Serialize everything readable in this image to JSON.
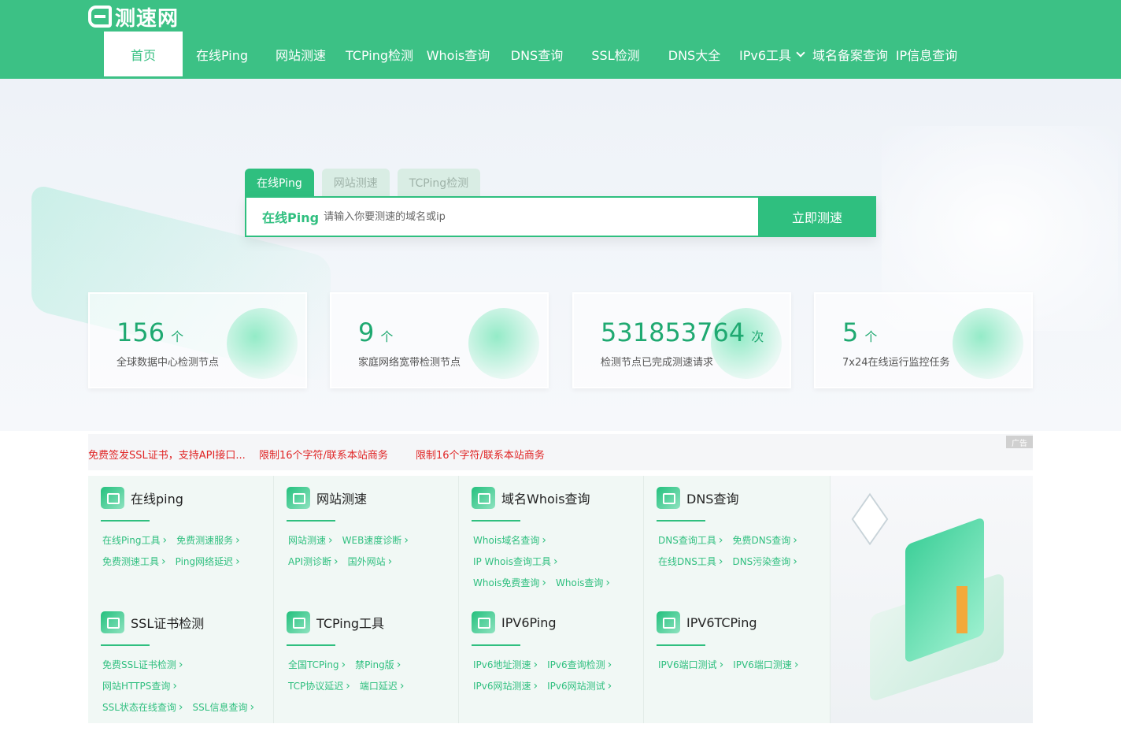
{
  "header": {
    "logo_text": "测速网",
    "nav": [
      {
        "label": "首页",
        "active": true
      },
      {
        "label": "在线Ping"
      },
      {
        "label": "网站测速"
      },
      {
        "label": "TCPing检测"
      },
      {
        "label": "Whois查询"
      },
      {
        "label": "DNS查询"
      },
      {
        "label": "SSL检测"
      },
      {
        "label": "DNS大全"
      },
      {
        "label": "IPv6工具"
      },
      {
        "label": "域名备案查询"
      },
      {
        "label": "IP信息查询"
      }
    ]
  },
  "search": {
    "tabs": [
      "在线Ping",
      "网站测速",
      "TCPing检测"
    ],
    "prefix": "在线Ping",
    "placeholder": "请输入你要测速的域名或ip",
    "button": "立即测速"
  },
  "stats": [
    {
      "value": "156",
      "unit": "个",
      "desc": "全球数据中心检测节点"
    },
    {
      "value": "9",
      "unit": "个",
      "desc": "家庭网络宽带检测节点"
    },
    {
      "value": "531853764",
      "unit": "次",
      "desc": "检测节点已完成测速请求"
    },
    {
      "value": "5",
      "unit": "个",
      "desc": "7x24在线运行监控任务"
    }
  ],
  "ads": {
    "links": [
      "免费签发SSL证书，支持API接口...",
      "限制16个字符/联系本站商务",
      "限制16个字符/联系本站商务"
    ],
    "tag": "广告"
  },
  "tools": [
    {
      "title": "在线ping",
      "icon": "ping-icon",
      "links": [
        "在线Ping工具",
        "免费测速服务",
        "免费测速工具",
        "Ping网络延迟"
      ]
    },
    {
      "title": "网站测速",
      "icon": "website-speed-icon",
      "links": [
        "网站测速",
        "WEB速度诊断",
        "API测诊断",
        "国外网站"
      ]
    },
    {
      "title": "域名Whois查询",
      "icon": "whois-icon",
      "links": [
        "Whois域名查询",
        "IP Whois查询工具",
        "Whois免费查询",
        "Whois查询"
      ]
    },
    {
      "title": "DNS查询",
      "icon": "dns-icon",
      "links": [
        "DNS查询工具",
        "免费DNS查询",
        "在线DNS工具",
        "DNS污染查询"
      ]
    },
    {
      "title": "SSL证书检测",
      "icon": "ssl-icon",
      "links": [
        "免费SSL证书检测",
        "网站HTTPS查询",
        "SSL状态在线查询",
        "SSL信息查询"
      ]
    },
    {
      "title": "TCPing工具",
      "icon": "tcping-icon",
      "links": [
        "全国TCPing",
        "禁Ping版",
        "TCP协议延迟",
        "端口延迟"
      ]
    },
    {
      "title": "IPV6Ping",
      "icon": "ipv6-ping-icon",
      "links": [
        "IPv6地址测速",
        "IPv6查询检测",
        "IPv6网站测速",
        "IPv6网站测试"
      ]
    },
    {
      "title": "IPV6TCPing",
      "icon": "ipv6-tcping-icon",
      "links": [
        "IPV6端口测试",
        "IPV6端口测速"
      ]
    }
  ]
}
